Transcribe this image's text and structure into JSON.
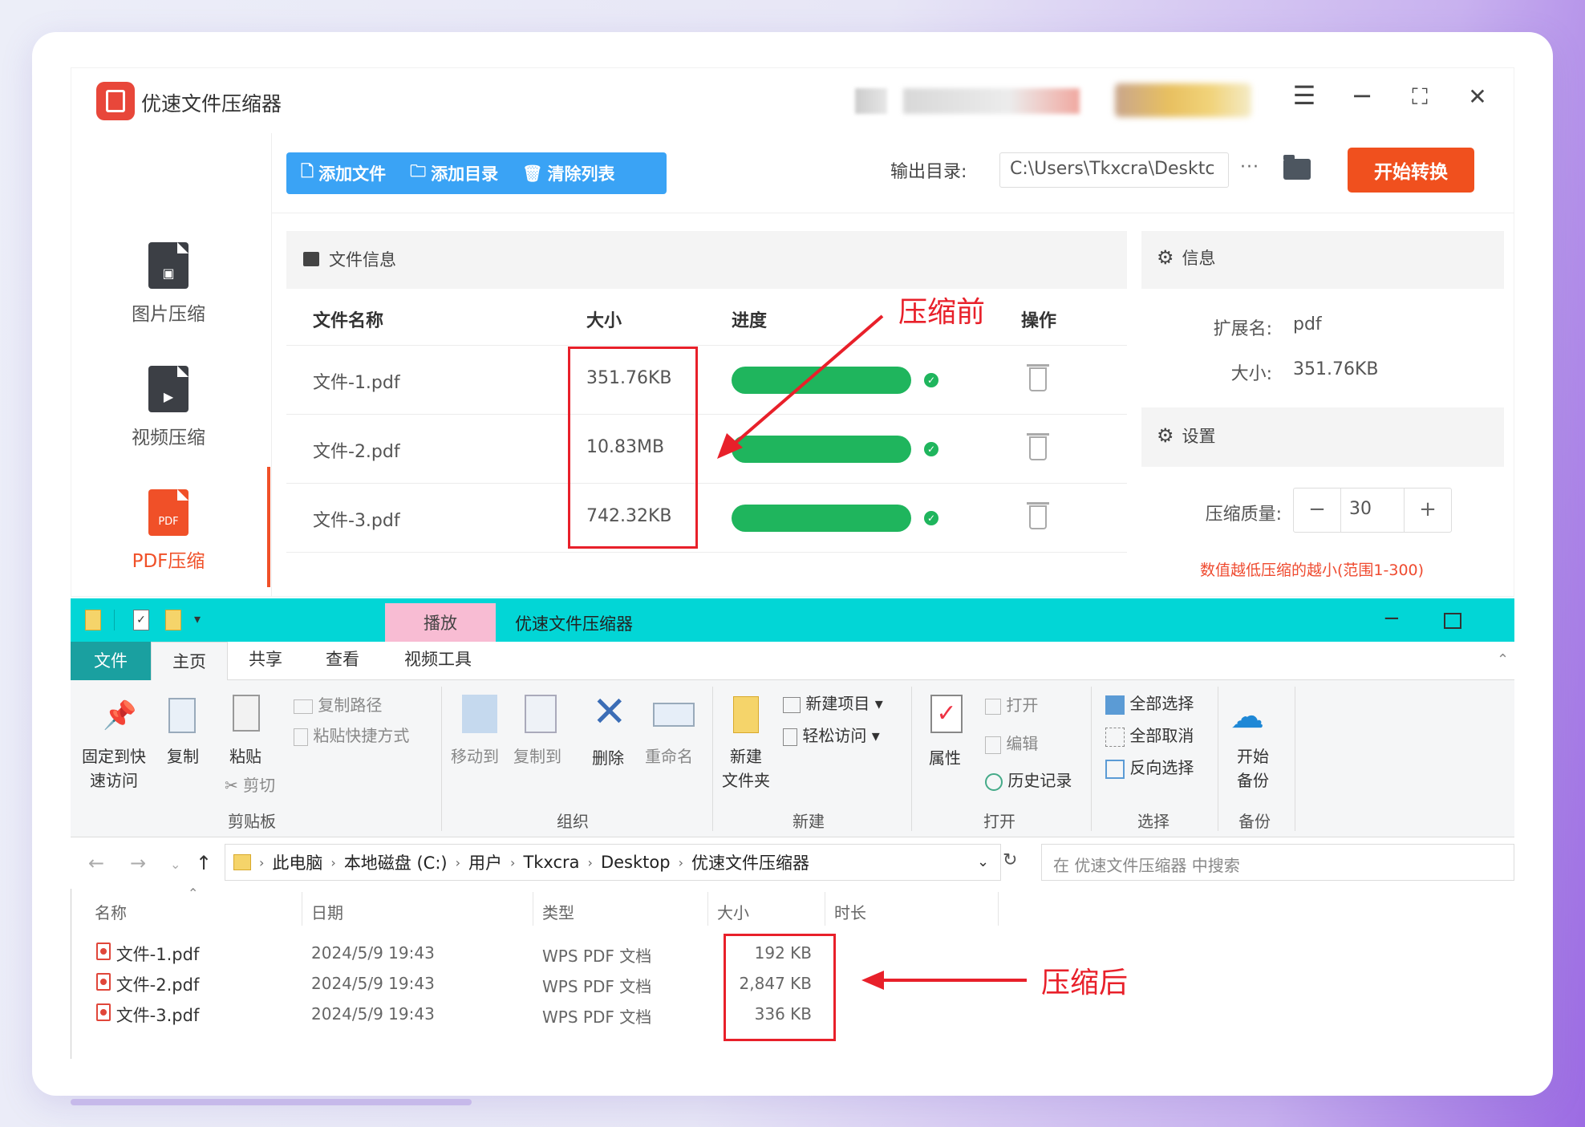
{
  "app": {
    "title": "优速文件压缩器",
    "toolbar": {
      "add_file": "添加文件",
      "add_dir": "添加目录",
      "clear_list": "清除列表"
    },
    "output_label": "输出目录:",
    "output_path": "C:\\Users\\Tkxcra\\Desktc",
    "output_more": "···",
    "start_button": "开始转换",
    "sidebar": [
      {
        "label": "图片压缩",
        "glyph": "▣"
      },
      {
        "label": "视频压缩",
        "glyph": "▶"
      },
      {
        "label": "PDF压缩",
        "glyph": "PDF"
      }
    ],
    "file_panel": {
      "title": "文件信息",
      "columns": {
        "name": "文件名称",
        "size": "大小",
        "progress": "进度",
        "action": "操作"
      },
      "rows": [
        {
          "name": "文件-1.pdf",
          "size": "351.76KB",
          "progress": 1.0
        },
        {
          "name": "文件-2.pdf",
          "size": "10.83MB",
          "progress": 1.0
        },
        {
          "name": "文件-3.pdf",
          "size": "742.32KB",
          "progress": 1.0
        }
      ]
    },
    "info": {
      "title": "信息",
      "ext_label": "扩展名:",
      "ext_value": "pdf",
      "size_label": "大小:",
      "size_value": "351.76KB"
    },
    "settings": {
      "title": "设置",
      "quality_label": "压缩质量:",
      "quality_value": "30",
      "minus": "−",
      "plus": "+",
      "hint": "数值越低压缩的越小(范围1-300)"
    },
    "window_controls": {
      "menu": "☰",
      "minimize": "−",
      "maximize": "⛶",
      "close": "✕"
    }
  },
  "annotations": {
    "before": "压缩前",
    "after": "压缩后"
  },
  "explorer": {
    "context_tab": "播放",
    "title": "优速文件压缩器",
    "tabs": {
      "file": "文件",
      "home": "主页",
      "share": "共享",
      "view": "查看",
      "video_tools": "视频工具"
    },
    "ribbon": {
      "pin": "固定到快速访问",
      "pin_l1": "固定到快",
      "pin_l2": "速访问",
      "copy": "复制",
      "paste": "粘贴",
      "copy_path": "复制路径",
      "paste_shortcut": "粘贴快捷方式",
      "cut": "剪切",
      "clipboard": "剪贴板",
      "move_to": "移动到",
      "copy_to": "复制到",
      "delete": "删除",
      "rename": "重命名",
      "organize": "组织",
      "new_folder_l1": "新建",
      "new_folder_l2": "文件夹",
      "new_item": "新建项目",
      "easy_access": "轻松访问",
      "new": "新建",
      "properties": "属性",
      "open": "打开",
      "edit": "编辑",
      "history": "历史记录",
      "open_group": "打开",
      "select_all": "全部选择",
      "select_none": "全部取消",
      "invert": "反向选择",
      "select_group": "选择",
      "backup_l1": "开始",
      "backup_l2": "备份",
      "backup_group": "备份"
    },
    "breadcrumb": [
      "此电脑",
      "本地磁盘 (C:)",
      "用户",
      "Tkxcra",
      "Desktop",
      "优速文件压缩器"
    ],
    "search_placeholder": "在 优速文件压缩器 中搜索",
    "columns": {
      "name": "名称",
      "date": "日期",
      "type": "类型",
      "size": "大小",
      "duration": "时长"
    },
    "files": [
      {
        "name": "文件-1.pdf",
        "date": "2024/5/9 19:43",
        "type": "WPS PDF 文档",
        "size": "192 KB"
      },
      {
        "name": "文件-2.pdf",
        "date": "2024/5/9 19:43",
        "type": "WPS PDF 文档",
        "size": "2,847 KB"
      },
      {
        "name": "文件-3.pdf",
        "date": "2024/5/9 19:43",
        "type": "WPS PDF 文档",
        "size": "336 KB"
      }
    ]
  },
  "colors": {
    "accent_blue": "#3aa3f5",
    "accent_orange": "#f05028",
    "progress_green": "#1fb55d",
    "annotation_red": "#e8202a",
    "explorer_title": "#02d6d6"
  }
}
